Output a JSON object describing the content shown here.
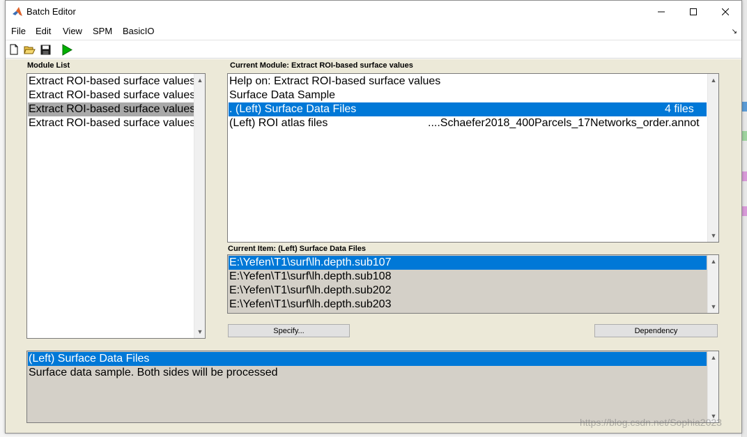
{
  "window": {
    "title": "Batch Editor",
    "controls": {
      "minimize": "—",
      "maximize": "☐",
      "close": "✕"
    }
  },
  "menu": {
    "items": [
      "File",
      "Edit",
      "View",
      "SPM",
      "BasicIO"
    ],
    "overflow_icon": "resize-arrow-icon"
  },
  "toolbar": {
    "icons": [
      "new-file-icon",
      "open-folder-icon",
      "save-icon",
      "run-icon"
    ],
    "run_color": "#00b000"
  },
  "module_list": {
    "label": "Module List",
    "items": [
      "Extract ROI-based surface values",
      "Extract ROI-based surface values",
      "Extract ROI-based surface values",
      "Extract ROI-based surface values"
    ],
    "selected_index": 2
  },
  "current_module": {
    "label": "Current Module: Extract ROI-based surface values",
    "rows": [
      {
        "left": "Help on: Extract ROI-based surface values",
        "right": ""
      },
      {
        "left": "Surface Data Sample",
        "right": ""
      },
      {
        "left": ". (Left) Surface Data Files",
        "right": "4 files"
      },
      {
        "left": "(Left) ROI atlas files",
        "right": "....Schaefer2018_400Parcels_17Networks_order.annot"
      }
    ],
    "selected_index": 2
  },
  "current_item": {
    "label": "Current Item: (Left) Surface Data Files",
    "files": [
      "E:\\Yefen\\T1\\surf\\lh.depth.sub107",
      "E:\\Yefen\\T1\\surf\\lh.depth.sub108",
      "E:\\Yefen\\T1\\surf\\lh.depth.sub202",
      "E:\\Yefen\\T1\\surf\\lh.depth.sub203"
    ],
    "selected_index": 0
  },
  "buttons": {
    "specify": "Specify...",
    "dependency": "Dependency"
  },
  "help_panel": {
    "title": "(Left) Surface Data Files",
    "text": "Surface data sample. Both sides will be processed"
  },
  "watermark": "https://blog.csdn.net/Sophia2023",
  "colors": {
    "selection_blue": "#0078d7",
    "selection_gray": "#a9a9a9",
    "panel_bg": "#ece9d8",
    "readonly_list_bg": "#d4d0c8"
  }
}
